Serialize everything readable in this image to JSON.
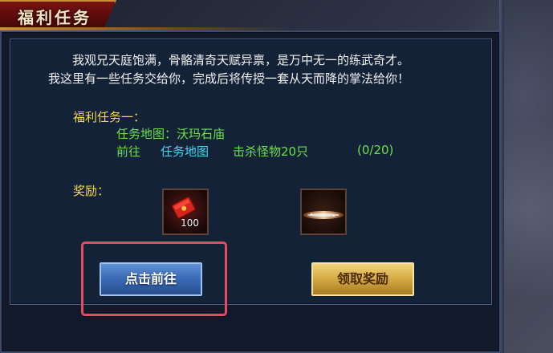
{
  "window": {
    "title": "福利任务"
  },
  "dialog": {
    "line1": "我观兄天庭饱满，骨骼清奇天赋异禀，是万中无一的练武奇才。",
    "line2": "我这里有一些任务交给你，完成后将传授一套从天而降的掌法给你！"
  },
  "quest": {
    "header": "福利任务一：",
    "map_line": "任务地图：沃玛石庙",
    "goto_label": "前往",
    "map_link": "任务地图",
    "task": "击杀怪物20只",
    "progress": "(0/20)"
  },
  "rewards": {
    "label": "奖励：",
    "items": [
      {
        "icon": "red-envelope-icon",
        "count": "100"
      },
      {
        "icon": "glowing-item-icon",
        "count": ""
      }
    ]
  },
  "buttons": {
    "go": "点击前往",
    "claim": "领取奖励"
  },
  "colors": {
    "title_bg": "#6a0e0e",
    "quest_header": "#f5d84a",
    "quest_green": "#6be04a",
    "map_link_cyan": "#47d6f0",
    "go_button": "#3c6cb6",
    "claim_button": "#d4a943",
    "highlight": "#e84a5f"
  }
}
